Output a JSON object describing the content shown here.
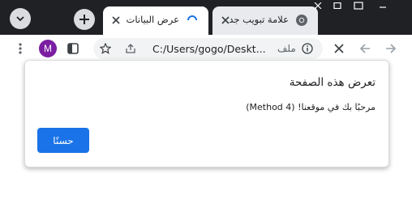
{
  "tabs": [
    {
      "title": "عرض البيانات",
      "state": "active",
      "loading": true
    },
    {
      "title": "علامة تبويب جد",
      "state": "inactive",
      "favicon": "chrome-icon"
    }
  ],
  "toolbar": {
    "profile_initial": "M",
    "address_url": "C:/Users/gogo/Deskt...",
    "address_site_label": "ملف",
    "icons": [
      "menu-dots-icon",
      "side-panel-icon",
      "bookmark-star-icon",
      "share-icon",
      "info-icon",
      "stop-icon",
      "back-icon",
      "forward-icon"
    ]
  },
  "dialog": {
    "title": "تعرض هذه الصفحة",
    "message": "مرحبًا بك في موقعنا! (Method 4)",
    "ok_label": "حسنًا"
  },
  "colors": {
    "tabstrip_bg": "#202124",
    "accent": "#1a73e8",
    "profile_bg": "#7b1fa2"
  }
}
